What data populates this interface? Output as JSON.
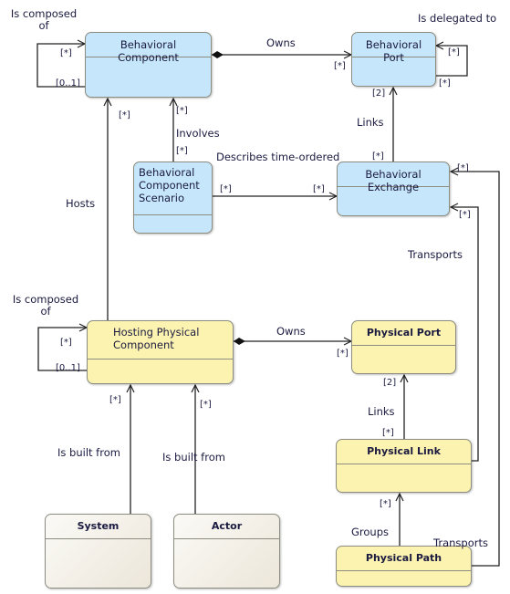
{
  "colors": {
    "behavioral": "#c6e6fb",
    "physical": "#fcf3b0",
    "external": "#ece6da",
    "line": "#1a1a1a",
    "text": "#1a1a40"
  },
  "classes": {
    "behavioral_component": "Behavioral Component",
    "behavioral_port": "Behavioral Port",
    "behavioral_component_scenario": "Behavioral Component Scenario",
    "behavioral_exchange": "Behavioral Exchange",
    "hosting_physical_component": "Hosting Physical Component",
    "physical_port": "Physical Port",
    "physical_link": "Physical Link",
    "physical_path": "Physical Path",
    "system": "System",
    "actor": "Actor"
  },
  "relations": {
    "bc_composed": {
      "label": "Is composed of",
      "m1": "[*]",
      "m2": "[0..1]"
    },
    "bc_owns": {
      "label": "Owns",
      "m": "[*]"
    },
    "bp_delegated": {
      "label": "Is delegated to",
      "m1": "[*]",
      "m2": "[*]"
    },
    "be_links": {
      "label": "Links",
      "m1": "[2]",
      "m2": "[*]"
    },
    "bcs_involves": {
      "label": "Involves",
      "m1": "[*]",
      "m2": "[*]"
    },
    "bcs_describes": {
      "label": "Describes time-ordered",
      "m1": "[*]",
      "m2": "[*]"
    },
    "hosts": {
      "label": "Hosts",
      "m": "[*]"
    },
    "pl_transports": {
      "label": "Transports",
      "m": "[*]"
    },
    "pp_transports": {
      "label": "Transports",
      "m": "[*]"
    },
    "hpc_composed": {
      "label": "Is composed of",
      "m1": "[*]",
      "m2": "[0..1]"
    },
    "hpc_owns": {
      "label": "Owns",
      "m": "[*]"
    },
    "pl_links": {
      "label": "Links",
      "m1": "[2]",
      "m2": "[*]"
    },
    "groups": {
      "label": "Groups",
      "m": "[*]"
    },
    "system_built": {
      "label": "Is built from",
      "m": "[*]"
    },
    "actor_built": {
      "label": "Is built from",
      "m": "[*]"
    }
  }
}
